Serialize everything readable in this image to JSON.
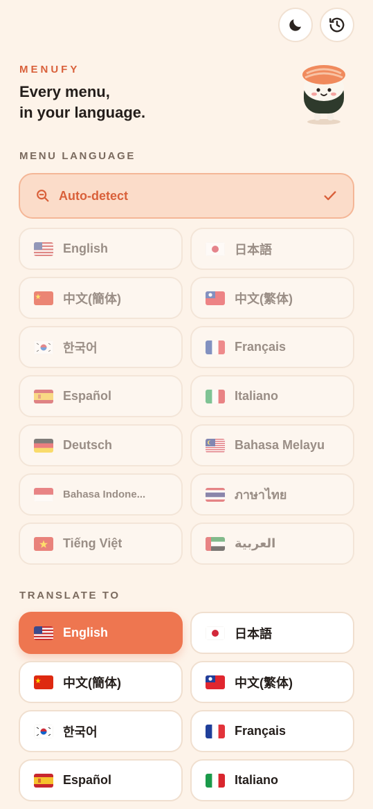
{
  "header": {
    "brand": "MENUFY",
    "tagline_line1": "Every menu,",
    "tagline_line2": "in your language."
  },
  "toolbar": {
    "dark_mode_icon": "moon-icon",
    "history_icon": "history-icon"
  },
  "menu_language": {
    "label": "MENU LANGUAGE",
    "auto_detect": {
      "label": "Auto-detect",
      "selected": true,
      "icon": "search-icon"
    },
    "options": [
      {
        "name": "English",
        "flag": "us"
      },
      {
        "name": "日本語",
        "flag": "jp"
      },
      {
        "name": "中文(簡体)",
        "flag": "cn"
      },
      {
        "name": "中文(繁体)",
        "flag": "tw"
      },
      {
        "name": "한국어",
        "flag": "kr"
      },
      {
        "name": "Français",
        "flag": "fr"
      },
      {
        "name": "Español",
        "flag": "es"
      },
      {
        "name": "Italiano",
        "flag": "it"
      },
      {
        "name": "Deutsch",
        "flag": "de"
      },
      {
        "name": "Bahasa Melayu",
        "flag": "my"
      },
      {
        "name": "Bahasa Indone...",
        "flag": "id"
      },
      {
        "name": "ภาษาไทย",
        "flag": "th"
      },
      {
        "name": "Tiếng Việt",
        "flag": "vn"
      },
      {
        "name": "العربية",
        "flag": "ae"
      }
    ]
  },
  "translate_to": {
    "label": "TRANSLATE TO",
    "selected": "English",
    "options": [
      {
        "name": "English",
        "flag": "us"
      },
      {
        "name": "日本語",
        "flag": "jp"
      },
      {
        "name": "中文(簡体)",
        "flag": "cn"
      },
      {
        "name": "中文(繁体)",
        "flag": "tw"
      },
      {
        "name": "한국어",
        "flag": "kr"
      },
      {
        "name": "Français",
        "flag": "fr"
      },
      {
        "name": "Español",
        "flag": "es"
      },
      {
        "name": "Italiano",
        "flag": "it"
      }
    ]
  },
  "colors": {
    "accent": "#ee7650",
    "brand": "#d9603a",
    "background": "#fdf3e9",
    "auto_detect_bg": "#fbdcc9"
  }
}
